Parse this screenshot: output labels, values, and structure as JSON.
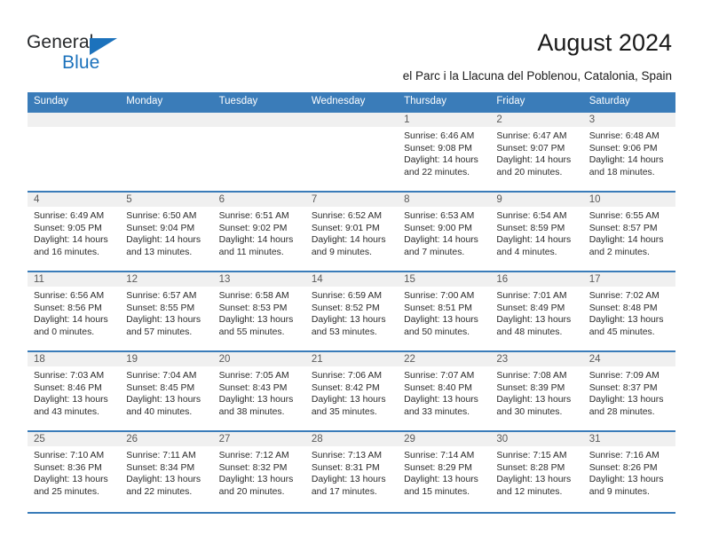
{
  "brand": {
    "word_one": "General",
    "word_two": "Blue",
    "accent_color": "#1c72bc",
    "triangle_icon": "triangle-icon"
  },
  "header": {
    "title": "August 2024",
    "subtitle": "el Parc i la Llacuna del Poblenou, Catalonia, Spain"
  },
  "calendar": {
    "header_bg": "#3a7cb9",
    "cell_head_bg": "#f0f0f0",
    "day_names": [
      "Sunday",
      "Monday",
      "Tuesday",
      "Wednesday",
      "Thursday",
      "Friday",
      "Saturday"
    ],
    "weeks": [
      [
        {
          "day": "",
          "lines": []
        },
        {
          "day": "",
          "lines": []
        },
        {
          "day": "",
          "lines": []
        },
        {
          "day": "",
          "lines": []
        },
        {
          "day": "1",
          "lines": [
            "Sunrise: 6:46 AM",
            "Sunset: 9:08 PM",
            "Daylight: 14 hours",
            "and 22 minutes."
          ]
        },
        {
          "day": "2",
          "lines": [
            "Sunrise: 6:47 AM",
            "Sunset: 9:07 PM",
            "Daylight: 14 hours",
            "and 20 minutes."
          ]
        },
        {
          "day": "3",
          "lines": [
            "Sunrise: 6:48 AM",
            "Sunset: 9:06 PM",
            "Daylight: 14 hours",
            "and 18 minutes."
          ]
        }
      ],
      [
        {
          "day": "4",
          "lines": [
            "Sunrise: 6:49 AM",
            "Sunset: 9:05 PM",
            "Daylight: 14 hours",
            "and 16 minutes."
          ]
        },
        {
          "day": "5",
          "lines": [
            "Sunrise: 6:50 AM",
            "Sunset: 9:04 PM",
            "Daylight: 14 hours",
            "and 13 minutes."
          ]
        },
        {
          "day": "6",
          "lines": [
            "Sunrise: 6:51 AM",
            "Sunset: 9:02 PM",
            "Daylight: 14 hours",
            "and 11 minutes."
          ]
        },
        {
          "day": "7",
          "lines": [
            "Sunrise: 6:52 AM",
            "Sunset: 9:01 PM",
            "Daylight: 14 hours",
            "and 9 minutes."
          ]
        },
        {
          "day": "8",
          "lines": [
            "Sunrise: 6:53 AM",
            "Sunset: 9:00 PM",
            "Daylight: 14 hours",
            "and 7 minutes."
          ]
        },
        {
          "day": "9",
          "lines": [
            "Sunrise: 6:54 AM",
            "Sunset: 8:59 PM",
            "Daylight: 14 hours",
            "and 4 minutes."
          ]
        },
        {
          "day": "10",
          "lines": [
            "Sunrise: 6:55 AM",
            "Sunset: 8:57 PM",
            "Daylight: 14 hours",
            "and 2 minutes."
          ]
        }
      ],
      [
        {
          "day": "11",
          "lines": [
            "Sunrise: 6:56 AM",
            "Sunset: 8:56 PM",
            "Daylight: 14 hours",
            "and 0 minutes."
          ]
        },
        {
          "day": "12",
          "lines": [
            "Sunrise: 6:57 AM",
            "Sunset: 8:55 PM",
            "Daylight: 13 hours",
            "and 57 minutes."
          ]
        },
        {
          "day": "13",
          "lines": [
            "Sunrise: 6:58 AM",
            "Sunset: 8:53 PM",
            "Daylight: 13 hours",
            "and 55 minutes."
          ]
        },
        {
          "day": "14",
          "lines": [
            "Sunrise: 6:59 AM",
            "Sunset: 8:52 PM",
            "Daylight: 13 hours",
            "and 53 minutes."
          ]
        },
        {
          "day": "15",
          "lines": [
            "Sunrise: 7:00 AM",
            "Sunset: 8:51 PM",
            "Daylight: 13 hours",
            "and 50 minutes."
          ]
        },
        {
          "day": "16",
          "lines": [
            "Sunrise: 7:01 AM",
            "Sunset: 8:49 PM",
            "Daylight: 13 hours",
            "and 48 minutes."
          ]
        },
        {
          "day": "17",
          "lines": [
            "Sunrise: 7:02 AM",
            "Sunset: 8:48 PM",
            "Daylight: 13 hours",
            "and 45 minutes."
          ]
        }
      ],
      [
        {
          "day": "18",
          "lines": [
            "Sunrise: 7:03 AM",
            "Sunset: 8:46 PM",
            "Daylight: 13 hours",
            "and 43 minutes."
          ]
        },
        {
          "day": "19",
          "lines": [
            "Sunrise: 7:04 AM",
            "Sunset: 8:45 PM",
            "Daylight: 13 hours",
            "and 40 minutes."
          ]
        },
        {
          "day": "20",
          "lines": [
            "Sunrise: 7:05 AM",
            "Sunset: 8:43 PM",
            "Daylight: 13 hours",
            "and 38 minutes."
          ]
        },
        {
          "day": "21",
          "lines": [
            "Sunrise: 7:06 AM",
            "Sunset: 8:42 PM",
            "Daylight: 13 hours",
            "and 35 minutes."
          ]
        },
        {
          "day": "22",
          "lines": [
            "Sunrise: 7:07 AM",
            "Sunset: 8:40 PM",
            "Daylight: 13 hours",
            "and 33 minutes."
          ]
        },
        {
          "day": "23",
          "lines": [
            "Sunrise: 7:08 AM",
            "Sunset: 8:39 PM",
            "Daylight: 13 hours",
            "and 30 minutes."
          ]
        },
        {
          "day": "24",
          "lines": [
            "Sunrise: 7:09 AM",
            "Sunset: 8:37 PM",
            "Daylight: 13 hours",
            "and 28 minutes."
          ]
        }
      ],
      [
        {
          "day": "25",
          "lines": [
            "Sunrise: 7:10 AM",
            "Sunset: 8:36 PM",
            "Daylight: 13 hours",
            "and 25 minutes."
          ]
        },
        {
          "day": "26",
          "lines": [
            "Sunrise: 7:11 AM",
            "Sunset: 8:34 PM",
            "Daylight: 13 hours",
            "and 22 minutes."
          ]
        },
        {
          "day": "27",
          "lines": [
            "Sunrise: 7:12 AM",
            "Sunset: 8:32 PM",
            "Daylight: 13 hours",
            "and 20 minutes."
          ]
        },
        {
          "day": "28",
          "lines": [
            "Sunrise: 7:13 AM",
            "Sunset: 8:31 PM",
            "Daylight: 13 hours",
            "and 17 minutes."
          ]
        },
        {
          "day": "29",
          "lines": [
            "Sunrise: 7:14 AM",
            "Sunset: 8:29 PM",
            "Daylight: 13 hours",
            "and 15 minutes."
          ]
        },
        {
          "day": "30",
          "lines": [
            "Sunrise: 7:15 AM",
            "Sunset: 8:28 PM",
            "Daylight: 13 hours",
            "and 12 minutes."
          ]
        },
        {
          "day": "31",
          "lines": [
            "Sunrise: 7:16 AM",
            "Sunset: 8:26 PM",
            "Daylight: 13 hours",
            "and 9 minutes."
          ]
        }
      ]
    ]
  }
}
